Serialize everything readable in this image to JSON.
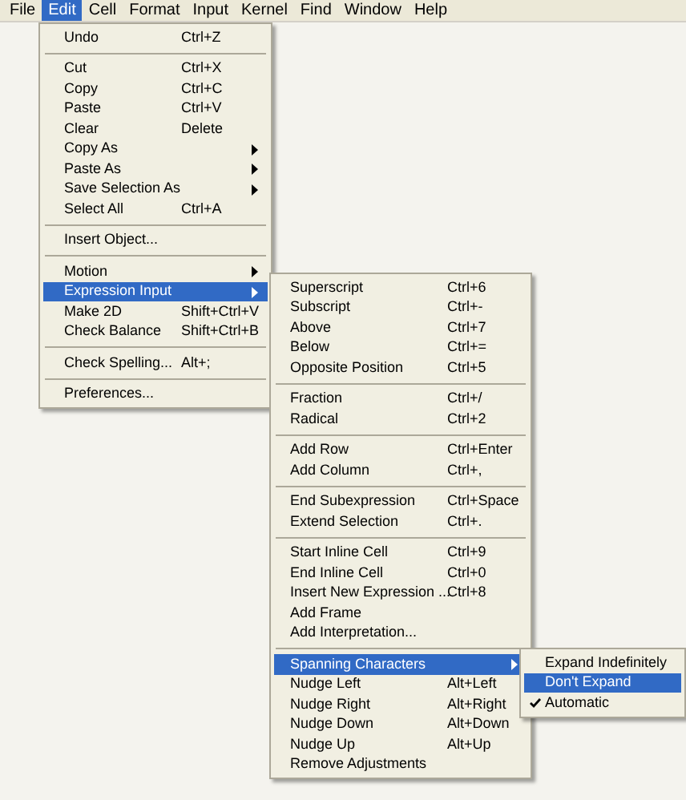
{
  "menubar": [
    {
      "label": "File",
      "selected": false
    },
    {
      "label": "Edit",
      "selected": true
    },
    {
      "label": "Cell",
      "selected": false
    },
    {
      "label": "Format",
      "selected": false
    },
    {
      "label": "Input",
      "selected": false
    },
    {
      "label": "Kernel",
      "selected": false
    },
    {
      "label": "Find",
      "selected": false
    },
    {
      "label": "Window",
      "selected": false
    },
    {
      "label": "Help",
      "selected": false
    }
  ],
  "menus": [
    {
      "items": [
        {
          "kind": "item",
          "label": "Undo",
          "shortcut": "Ctrl+Z",
          "selected": false
        },
        {
          "kind": "separator"
        },
        {
          "kind": "item",
          "label": "Cut",
          "shortcut": "Ctrl+X",
          "selected": false
        },
        {
          "kind": "item",
          "label": "Copy",
          "shortcut": "Ctrl+C",
          "selected": false
        },
        {
          "kind": "item",
          "label": "Paste",
          "shortcut": "Ctrl+V",
          "selected": false
        },
        {
          "kind": "item",
          "label": "Clear",
          "shortcut": "Delete",
          "selected": false
        },
        {
          "kind": "submenu",
          "label": "Copy As",
          "selected": false
        },
        {
          "kind": "submenu",
          "label": "Paste As",
          "selected": false
        },
        {
          "kind": "submenu",
          "label": "Save Selection As",
          "selected": false
        },
        {
          "kind": "item",
          "label": "Select All",
          "shortcut": "Ctrl+A",
          "selected": false
        },
        {
          "kind": "separator"
        },
        {
          "kind": "item",
          "label": "Insert Object...",
          "selected": false
        },
        {
          "kind": "separator"
        },
        {
          "kind": "submenu",
          "label": "Motion",
          "selected": false
        },
        {
          "kind": "submenu",
          "label": "Expression Input",
          "selected": true
        },
        {
          "kind": "item",
          "label": "Make 2D",
          "shortcut": "Shift+Ctrl+V",
          "selected": false
        },
        {
          "kind": "item",
          "label": "Check Balance",
          "shortcut": "Shift+Ctrl+B",
          "selected": false
        },
        {
          "kind": "separator"
        },
        {
          "kind": "item",
          "label": "Check Spelling...",
          "shortcut": "Alt+;",
          "selected": false
        },
        {
          "kind": "separator"
        },
        {
          "kind": "item",
          "label": "Preferences...",
          "selected": false
        }
      ]
    },
    {
      "items": [
        {
          "kind": "item",
          "label": "Superscript",
          "shortcut": "Ctrl+6",
          "selected": false
        },
        {
          "kind": "item",
          "label": "Subscript",
          "shortcut": "Ctrl+-",
          "selected": false
        },
        {
          "kind": "item",
          "label": "Above",
          "shortcut": "Ctrl+7",
          "selected": false
        },
        {
          "kind": "item",
          "label": "Below",
          "shortcut": "Ctrl+=",
          "selected": false
        },
        {
          "kind": "item",
          "label": "Opposite Position",
          "shortcut": "Ctrl+5",
          "selected": false
        },
        {
          "kind": "separator"
        },
        {
          "kind": "item",
          "label": "Fraction",
          "shortcut": "Ctrl+/",
          "selected": false
        },
        {
          "kind": "item",
          "label": "Radical",
          "shortcut": "Ctrl+2",
          "selected": false
        },
        {
          "kind": "separator"
        },
        {
          "kind": "item",
          "label": "Add Row",
          "shortcut": "Ctrl+Enter",
          "selected": false
        },
        {
          "kind": "item",
          "label": "Add Column",
          "shortcut": "Ctrl+,",
          "selected": false
        },
        {
          "kind": "separator"
        },
        {
          "kind": "item",
          "label": "End Subexpression",
          "shortcut": "Ctrl+Space",
          "selected": false
        },
        {
          "kind": "item",
          "label": "Extend Selection",
          "shortcut": "Ctrl+.",
          "selected": false
        },
        {
          "kind": "separator"
        },
        {
          "kind": "item",
          "label": "Start Inline Cell",
          "shortcut": "Ctrl+9",
          "selected": false
        },
        {
          "kind": "item",
          "label": "End Inline Cell",
          "shortcut": "Ctrl+0",
          "selected": false
        },
        {
          "kind": "item",
          "label": "Insert New Expression ...",
          "shortcut": "Ctrl+8",
          "selected": false
        },
        {
          "kind": "item",
          "label": "Add Frame",
          "selected": false
        },
        {
          "kind": "item",
          "label": "Add Interpretation...",
          "selected": false
        },
        {
          "kind": "separator"
        },
        {
          "kind": "submenu",
          "label": "Spanning Characters",
          "selected": true
        },
        {
          "kind": "item",
          "label": "Nudge Left",
          "shortcut": "Alt+Left",
          "selected": false
        },
        {
          "kind": "item",
          "label": "Nudge Right",
          "shortcut": "Alt+Right",
          "selected": false
        },
        {
          "kind": "item",
          "label": "Nudge Down",
          "shortcut": "Alt+Down",
          "selected": false
        },
        {
          "kind": "item",
          "label": "Nudge Up",
          "shortcut": "Alt+Up",
          "selected": false
        },
        {
          "kind": "item",
          "label": "Remove Adjustments",
          "selected": false
        }
      ]
    },
    {
      "items": [
        {
          "kind": "option",
          "label": "Expand Indefinitely",
          "selected": false,
          "checked": false
        },
        {
          "kind": "option",
          "label": "Don't Expand",
          "selected": true,
          "checked": false
        },
        {
          "kind": "option",
          "label": "Automatic",
          "selected": false,
          "checked": true
        }
      ]
    }
  ]
}
